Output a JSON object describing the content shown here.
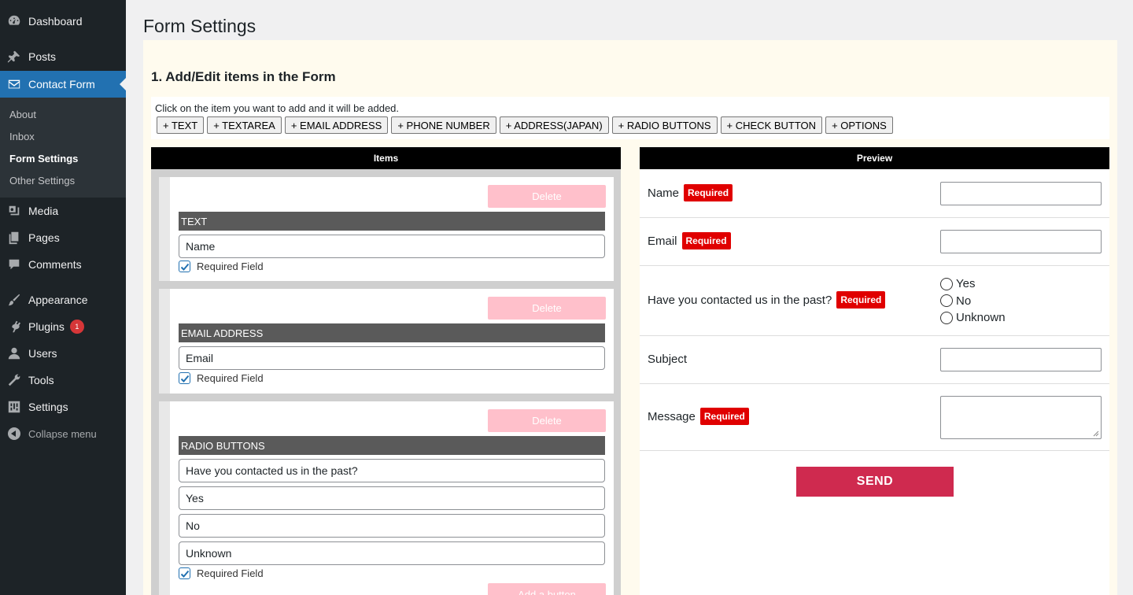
{
  "sidebar": {
    "menu": [
      {
        "label": "Dashboard",
        "icon": "dashboard-icon"
      },
      {
        "label": "Posts",
        "icon": "pin-icon"
      },
      {
        "label": "Contact Form",
        "icon": "mail-icon"
      },
      {
        "label": "Media",
        "icon": "media-icon"
      },
      {
        "label": "Pages",
        "icon": "pages-icon"
      },
      {
        "label": "Comments",
        "icon": "comment-icon"
      },
      {
        "label": "Appearance",
        "icon": "brush-icon"
      },
      {
        "label": "Plugins",
        "icon": "plug-icon",
        "badge": "1"
      },
      {
        "label": "Users",
        "icon": "user-icon"
      },
      {
        "label": "Tools",
        "icon": "wrench-icon"
      },
      {
        "label": "Settings",
        "icon": "settings-icon"
      }
    ],
    "submenu": [
      "About",
      "Inbox",
      "Form Settings",
      "Other Settings"
    ],
    "collapse_label": "Collapse menu"
  },
  "page_title": "Form Settings",
  "section_title": "1. Add/Edit items in the Form",
  "add_hint": "Click on the item you want to add and it will be added.",
  "add_buttons": [
    "+ TEXT",
    "+ TEXTAREA",
    "+ EMAIL ADDRESS",
    "+ PHONE NUMBER",
    "+ ADDRESS(JAPAN)",
    "+ RADIO BUTTONS",
    "+ CHECK BUTTON",
    "+ OPTIONS"
  ],
  "items_header": "Items",
  "preview_header": "Preview",
  "delete_label": "Delete",
  "required_field_label": "Required Field",
  "add_button_label": "Add a button",
  "items": [
    {
      "type": "TEXT",
      "fields": [
        "Name"
      ],
      "required": true
    },
    {
      "type": "EMAIL ADDRESS",
      "fields": [
        "Email"
      ],
      "required": true
    },
    {
      "type": "RADIO BUTTONS",
      "fields": [
        "Have you contacted us in the past?",
        "Yes",
        "No",
        "Unknown"
      ],
      "required": true
    }
  ],
  "required_badge": "Required",
  "preview": {
    "name_label": "Name",
    "email_label": "Email",
    "contacted_label": "Have you contacted us in the past?",
    "contacted_options": [
      "Yes",
      "No",
      "Unknown"
    ],
    "subject_label": "Subject",
    "message_label": "Message",
    "send_label": "SEND"
  },
  "colors": {
    "sidebar_bg": "#1d2327",
    "active_menu": "#2271b1",
    "required_badge": "#e00000",
    "send_button": "#cf2a4f",
    "delete_button": "#ffc0cb",
    "panel_bg": "#fffbee"
  }
}
